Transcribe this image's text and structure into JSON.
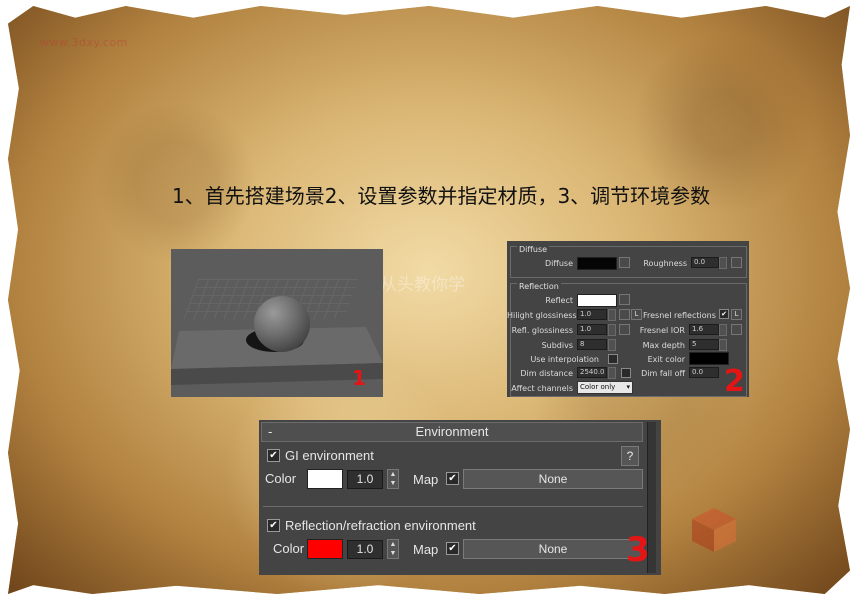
{
  "watermark_url": "www.3dxy.com",
  "bg_watermark": "从头教你学",
  "heading": "1、首先搭建场景2、设置参数并指定材质，3、调节环境参数",
  "markers": {
    "one": "1",
    "two": "2",
    "three": "3"
  },
  "material_panel": {
    "diffuse_group": "Diffuse",
    "diffuse_label": "Diffuse",
    "roughness_label": "Roughness",
    "roughness_value": "0.0",
    "reflection_group": "Reflection",
    "reflect_label": "Reflect",
    "hilight_label": "Hilight glossiness",
    "hilight_value": "1.0",
    "hilight_lock": "L",
    "fresnel_label": "Fresnel reflections",
    "fresnel_lock": "L",
    "refl_gloss_label": "Refl. glossiness",
    "refl_gloss_value": "1.0",
    "fresnel_ior_label": "Fresnel IOR",
    "fresnel_ior_value": "1.6",
    "subdivs_label": "Subdivs",
    "subdivs_value": "8",
    "max_depth_label": "Max depth",
    "max_depth_value": "5",
    "use_interp_label": "Use interpolation",
    "exit_color_label": "Exit color",
    "dim_distance_label": "Dim distance",
    "dim_distance_value": "2540.0",
    "dim_falloff_label": "Dim fall off",
    "dim_falloff_value": "0.0",
    "affect_channels_label": "Affect channels",
    "affect_channels_value": "Color only",
    "colors": {
      "diffuse": "#050505",
      "reflect": "#ffffff",
      "exit": "#000000"
    }
  },
  "environment_panel": {
    "collapse": "-",
    "title": "Environment",
    "gi_label": "GI environment",
    "help": "?",
    "gi_color_label": "Color",
    "gi_value": "1.0",
    "gi_map_label": "Map",
    "gi_map_button": "None",
    "refl_label": "Reflection/refraction environment",
    "refl_color_label": "Color",
    "refl_value": "1.0",
    "refl_map_label": "Map",
    "refl_map_button": "None",
    "colors": {
      "gi": "#ffffff",
      "refl": "#ff0000"
    }
  }
}
